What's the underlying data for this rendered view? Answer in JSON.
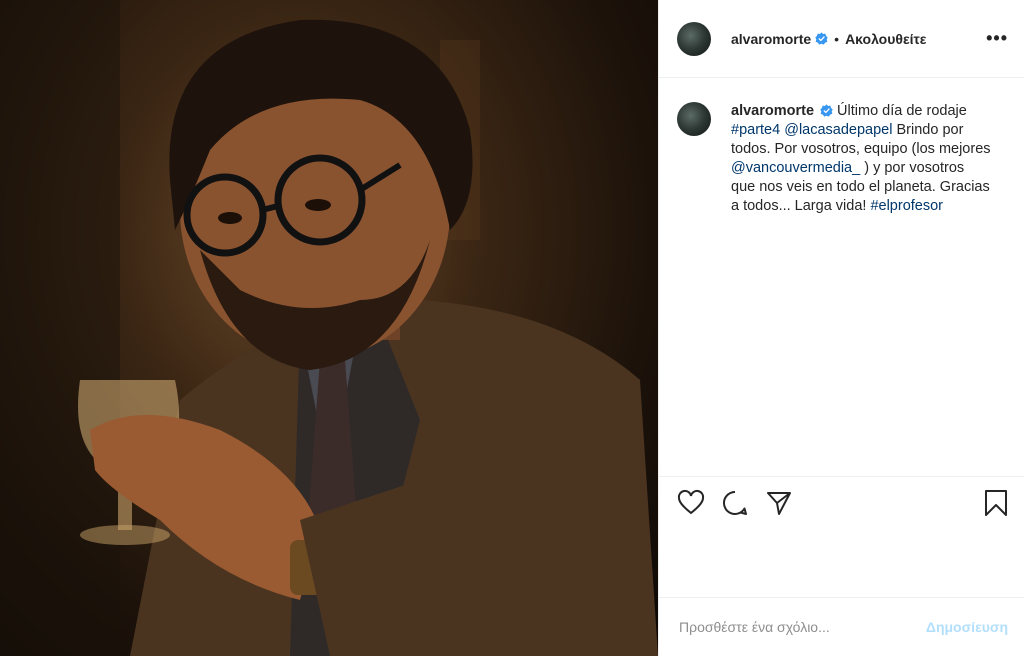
{
  "header": {
    "username": "alvaromorte",
    "separator": "•",
    "follow_label": "Ακολουθείτε",
    "more_label": "•••",
    "avatar_icon": "avatar-icon",
    "verified_icon": "verified-badge-icon"
  },
  "caption": {
    "username": "alvaromorte",
    "text_1": " Último día de rodaje ",
    "hashtag_1": "#parte4",
    "mention_1": "@lacasadepapel",
    "text_2": " Brindo por todos. Por vosotros, equipo (los mejores ",
    "mention_2": "@vancouvermedia_",
    "text_3": " ) y por vosotros que nos veis en todo el planeta. Gracias a todos... Larga vida! ",
    "hashtag_2": "#elprofesor",
    "link_color": "#00376b"
  },
  "actions": {
    "like_icon": "heart-icon",
    "comment_icon": "comment-icon",
    "share_icon": "share-icon",
    "save_icon": "bookmark-icon"
  },
  "comment": {
    "placeholder": "Προσθέστε ένα σχόλιο...",
    "post_label": "Δημοσίευση",
    "post_color": "#b2dffc"
  }
}
